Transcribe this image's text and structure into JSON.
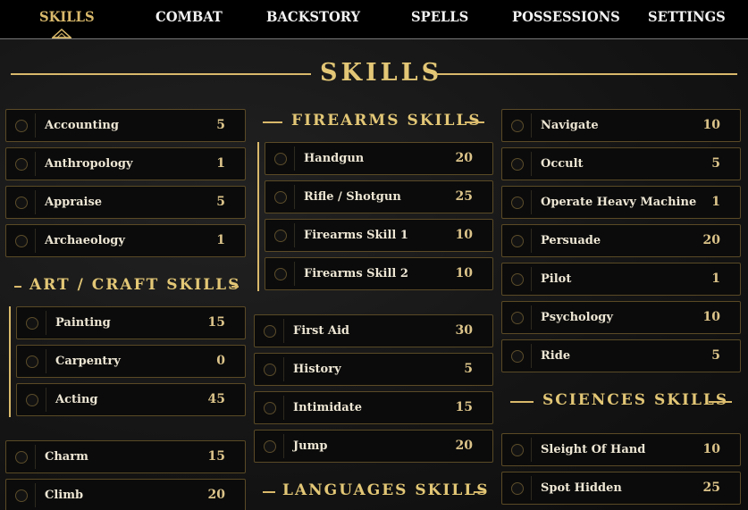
{
  "nav": {
    "tabs": [
      {
        "label": "SKILLS",
        "active": true
      },
      {
        "label": "COMBAT",
        "active": false
      },
      {
        "label": "BACKSTORY",
        "active": false
      },
      {
        "label": "SPELLS",
        "active": false
      },
      {
        "label": "POSSESSIONS",
        "active": false
      },
      {
        "label": "SETTINGS",
        "active": false
      }
    ]
  },
  "main_title": "SKILLS",
  "left": {
    "skills": [
      {
        "name": "Accounting",
        "value": "5"
      },
      {
        "name": "Anthropology",
        "value": "1"
      },
      {
        "name": "Appraise",
        "value": "5"
      },
      {
        "name": "Archaeology",
        "value": "1"
      }
    ],
    "art_craft_title": "ART / CRAFT SKILLS",
    "art_craft": [
      {
        "name": "Painting",
        "value": "15"
      },
      {
        "name": "Carpentry",
        "value": "0"
      },
      {
        "name": "Acting",
        "value": "45"
      }
    ],
    "more": [
      {
        "name": "Charm",
        "value": "15"
      },
      {
        "name": "Climb",
        "value": "20"
      }
    ]
  },
  "middle": {
    "firearms_title": "FIREARMS SKILLS",
    "firearms": [
      {
        "name": "Handgun",
        "value": "20"
      },
      {
        "name": "Rifle / Shotgun",
        "value": "25"
      },
      {
        "name": "Firearms Skill 1",
        "value": "10"
      },
      {
        "name": "Firearms Skill 2",
        "value": "10"
      }
    ],
    "skills": [
      {
        "name": "First Aid",
        "value": "30"
      },
      {
        "name": "History",
        "value": "5"
      },
      {
        "name": "Intimidate",
        "value": "15"
      },
      {
        "name": "Jump",
        "value": "20"
      }
    ],
    "languages_title": "LANGUAGES SKILLS"
  },
  "right": {
    "skills": [
      {
        "name": "Navigate",
        "value": "10"
      },
      {
        "name": "Occult",
        "value": "5"
      },
      {
        "name": "Operate Heavy Machine",
        "value": "1"
      },
      {
        "name": "Persuade",
        "value": "20"
      },
      {
        "name": "Pilot",
        "value": "1"
      },
      {
        "name": "Psychology",
        "value": "10"
      },
      {
        "name": "Ride",
        "value": "5"
      }
    ],
    "sciences_title": "SCIENCES SKILLS",
    "more": [
      {
        "name": "Sleight Of Hand",
        "value": "10"
      },
      {
        "name": "Spot Hidden",
        "value": "25"
      }
    ]
  },
  "colors": {
    "accent": "#d9b96b",
    "background": "#141414",
    "row_border": "#5a4a26"
  }
}
